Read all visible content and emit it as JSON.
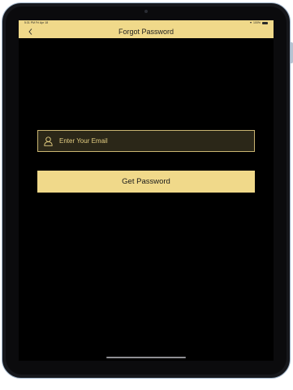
{
  "status_bar": {
    "time": "5:31 PM  Fri Apr 18",
    "battery": "100%",
    "wifi_icon": "wifi-icon",
    "battery_icon": "battery-icon"
  },
  "nav": {
    "title": "Forgot Password",
    "back_icon": "chevron-left-icon"
  },
  "form": {
    "email_placeholder": "Enter Your Email",
    "email_value": "",
    "email_icon": "user-icon",
    "submit_label": "Get Password"
  },
  "colors": {
    "accent": "#f0d98a",
    "field_background": "#2b2718",
    "field_border": "#c9b471",
    "screen_background": "#000000"
  }
}
